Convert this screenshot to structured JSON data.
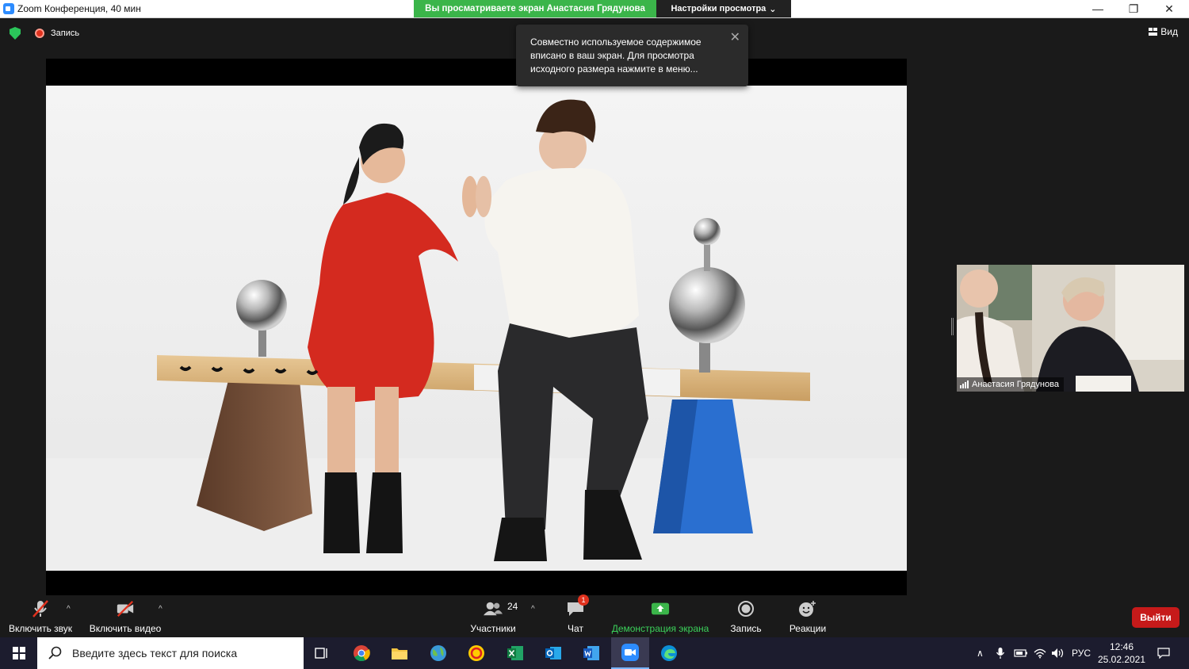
{
  "window": {
    "title": "Zoom Конференция, 40 мин",
    "share_banner": "Вы просматриваете экран Анастасия Грядунова",
    "view_settings": "Настройки просмотра",
    "minimize": "—",
    "restore": "❐",
    "close": "✕"
  },
  "meeting": {
    "recording_label": "Запись",
    "view_label": "Вид",
    "toast_text": "Совместно используемое содержимое вписано в ваш экран. Для просмотра исходного размера нажмите в меню...",
    "toast_close": "✕",
    "participant_name": "Анастасия Грядунова"
  },
  "toolbar": {
    "mute_label": "Включить звук",
    "video_label": "Включить видео",
    "participants_label": "Участники",
    "participants_count": "24",
    "chat_label": "Чат",
    "chat_badge": "1",
    "share_label": "Демонстрация экрана",
    "record_label": "Запись",
    "reactions_label": "Реакции",
    "leave_label": "Выйти"
  },
  "taskbar": {
    "search_placeholder": "Введите здесь текст для поиска",
    "language": "РУС",
    "time": "12:46",
    "date": "25.02.2021"
  },
  "colors": {
    "share_green": "#3bb54a",
    "leave_red": "#c61a1a",
    "dress_red": "#d42a1f",
    "stand_blue": "#2a6fd0"
  }
}
